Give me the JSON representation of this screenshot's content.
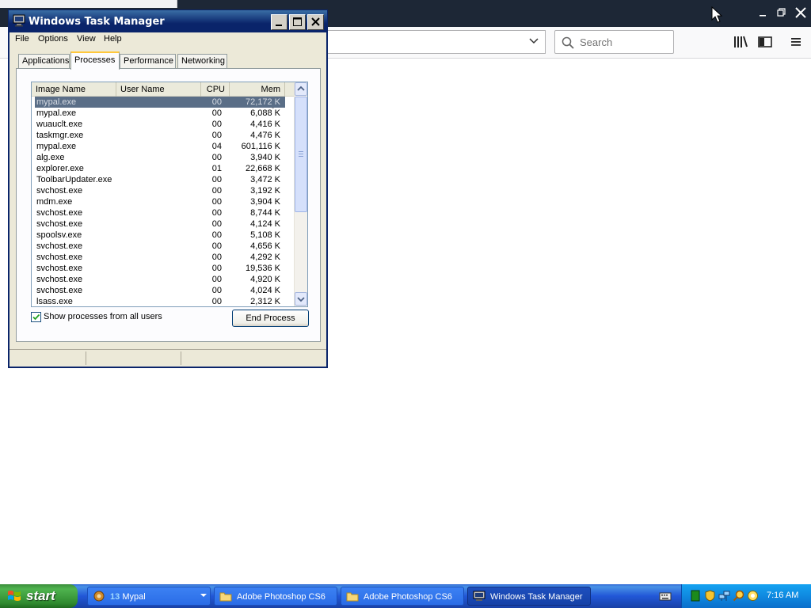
{
  "browser": {
    "search_placeholder": "Search"
  },
  "taskmgr": {
    "title": "Windows Task Manager",
    "menu": [
      "File",
      "Options",
      "View",
      "Help"
    ],
    "tabs": [
      "Applications",
      "Processes",
      "Performance",
      "Networking"
    ],
    "active_tab": "Processes",
    "columns": [
      "Image Name",
      "User Name",
      "CPU",
      "Mem Usage"
    ],
    "processes": [
      {
        "name": "mypal.exe",
        "cpu": "00",
        "mem": "72,172 K",
        "selected": true
      },
      {
        "name": "mypal.exe",
        "cpu": "00",
        "mem": "6,088 K"
      },
      {
        "name": "wuauclt.exe",
        "cpu": "00",
        "mem": "4,416 K"
      },
      {
        "name": "taskmgr.exe",
        "cpu": "00",
        "mem": "4,476 K"
      },
      {
        "name": "mypal.exe",
        "cpu": "04",
        "mem": "601,116 K"
      },
      {
        "name": "alg.exe",
        "cpu": "00",
        "mem": "3,940 K"
      },
      {
        "name": "explorer.exe",
        "cpu": "01",
        "mem": "22,668 K"
      },
      {
        "name": "ToolbarUpdater.exe",
        "cpu": "00",
        "mem": "3,472 K"
      },
      {
        "name": "svchost.exe",
        "cpu": "00",
        "mem": "3,192 K"
      },
      {
        "name": "mdm.exe",
        "cpu": "00",
        "mem": "3,904 K"
      },
      {
        "name": "svchost.exe",
        "cpu": "00",
        "mem": "8,744 K"
      },
      {
        "name": "svchost.exe",
        "cpu": "00",
        "mem": "4,124 K"
      },
      {
        "name": "spoolsv.exe",
        "cpu": "00",
        "mem": "5,108 K"
      },
      {
        "name": "svchost.exe",
        "cpu": "00",
        "mem": "4,656 K"
      },
      {
        "name": "svchost.exe",
        "cpu": "00",
        "mem": "4,292 K"
      },
      {
        "name": "svchost.exe",
        "cpu": "00",
        "mem": "19,536 K"
      },
      {
        "name": "svchost.exe",
        "cpu": "00",
        "mem": "4,920 K"
      },
      {
        "name": "svchost.exe",
        "cpu": "00",
        "mem": "4,024 K"
      },
      {
        "name": "lsass.exe",
        "cpu": "00",
        "mem": "2,312 K"
      }
    ],
    "show_all_users_label": "Show processes from all users",
    "show_all_users_checked": true,
    "end_process_label": "End Process"
  },
  "taskbar": {
    "start_label": "start",
    "buttons": [
      {
        "count": "13",
        "label": "Mypal",
        "icon": "mypal-icon"
      },
      {
        "label": "Adobe Photoshop CS6",
        "icon": "folder-icon"
      },
      {
        "label": "Adobe Photoshop CS6",
        "icon": "folder-icon"
      },
      {
        "label": "Windows Task Manager",
        "icon": "taskmgr-icon",
        "active": true
      }
    ],
    "clock": "7:16 AM"
  },
  "colors": {
    "xp_blue": "#0a246a",
    "selection": "#5a6e87",
    "taskbar": "#2157d7",
    "start_green": "#3c8f3c"
  }
}
